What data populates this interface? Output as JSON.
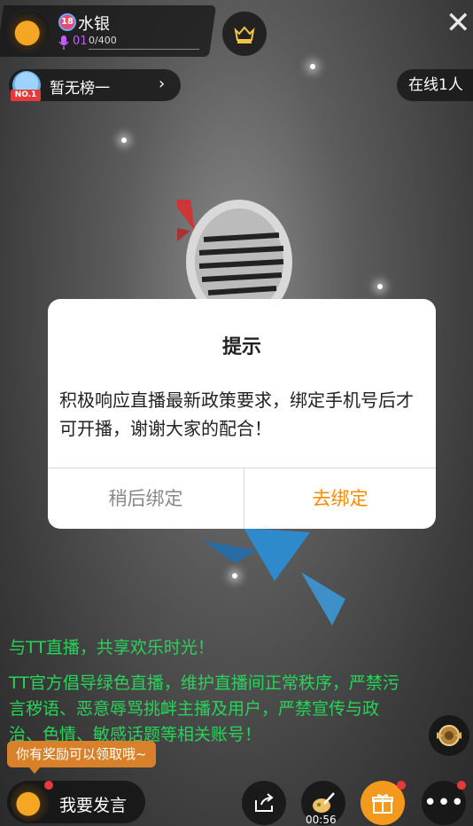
{
  "header": {
    "level_badge": "18",
    "anchor_name": "水银",
    "mic_level": "01",
    "mic_progress": "0/400",
    "close_glyph": "✕"
  },
  "ranking": {
    "label": "暂无榜一",
    "badge": "NO.1",
    "chevron": "›",
    "online": "在线1人"
  },
  "dialog": {
    "title": "提示",
    "message": "积极响应直播最新政策要求，绑定手机号后才可开播，谢谢大家的配合！",
    "cancel_label": "稍后绑定",
    "confirm_label": "去绑定",
    "confirm_color": "#ff8a00"
  },
  "chat": {
    "welcome": "与TT直播，共享欢乐时光！",
    "notice": "TT官方倡导绿色直播，维护直播间正常秩序，严禁污言秽语、恶意辱骂挑衅主播及用户，严禁宣传与政治、色情、敏感话题等相关账号！",
    "text_color": "#27d45a"
  },
  "reward_tip": "你有奖励可以领取哦~",
  "bottom_bar": {
    "speak_label": "我要发言",
    "timer": "00:56",
    "more_glyph": "•••"
  }
}
